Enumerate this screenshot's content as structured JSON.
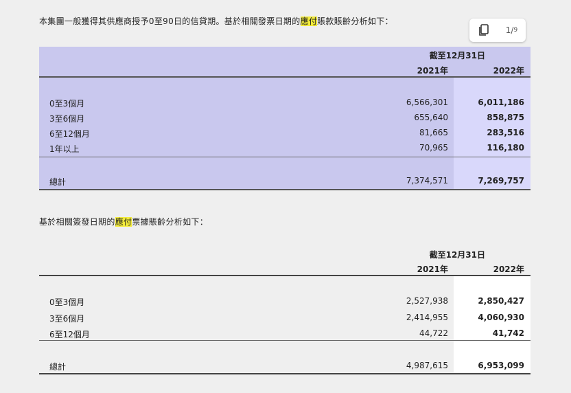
{
  "intro1": {
    "before": "本集團一般獲得其供應商授予0至90日的信貸期。基於相關發票日期的",
    "highlight": "應付",
    "after": "賬款賬齡分析如下："
  },
  "toolbar": {
    "copy_icon": "copy-icon",
    "page_current": "1",
    "page_total": "9"
  },
  "table1": {
    "period_header": "截至12月31日",
    "col_2021": "2021年",
    "col_2022": "2022年",
    "rows": [
      {
        "label": "0至3個月",
        "v2021": "6,566,301",
        "v2022": "6,011,186"
      },
      {
        "label": "3至6個月",
        "v2021": "655,640",
        "v2022": "858,875"
      },
      {
        "label": "6至12個月",
        "v2021": "81,665",
        "v2022": "283,516"
      },
      {
        "label": "1年以上",
        "v2021": "70,965",
        "v2022": "116,180"
      }
    ],
    "total": {
      "label": "總計",
      "v2021": "7,374,571",
      "v2022": "7,269,757"
    }
  },
  "intro2": {
    "before": "基於相關簽發日期的",
    "highlight": "應付",
    "after": "票據賬齡分析如下："
  },
  "table2": {
    "period_header": "截至12月31日",
    "col_2021": "2021年",
    "col_2022": "2022年",
    "rows": [
      {
        "label": "0至3個月",
        "v2021": "2,527,938",
        "v2022": "2,850,427"
      },
      {
        "label": "3至6個月",
        "v2021": "2,414,955",
        "v2022": "4,060,930"
      },
      {
        "label": "6至12個月",
        "v2021": "44,722",
        "v2022": "41,742"
      }
    ],
    "total": {
      "label": "總計",
      "v2021": "4,987,615",
      "v2022": "6,953,099"
    }
  },
  "colors": {
    "highlight": "#f3ec3a",
    "selection_bg": "#c9c8ee",
    "selection_col": "#d9d8fb"
  }
}
